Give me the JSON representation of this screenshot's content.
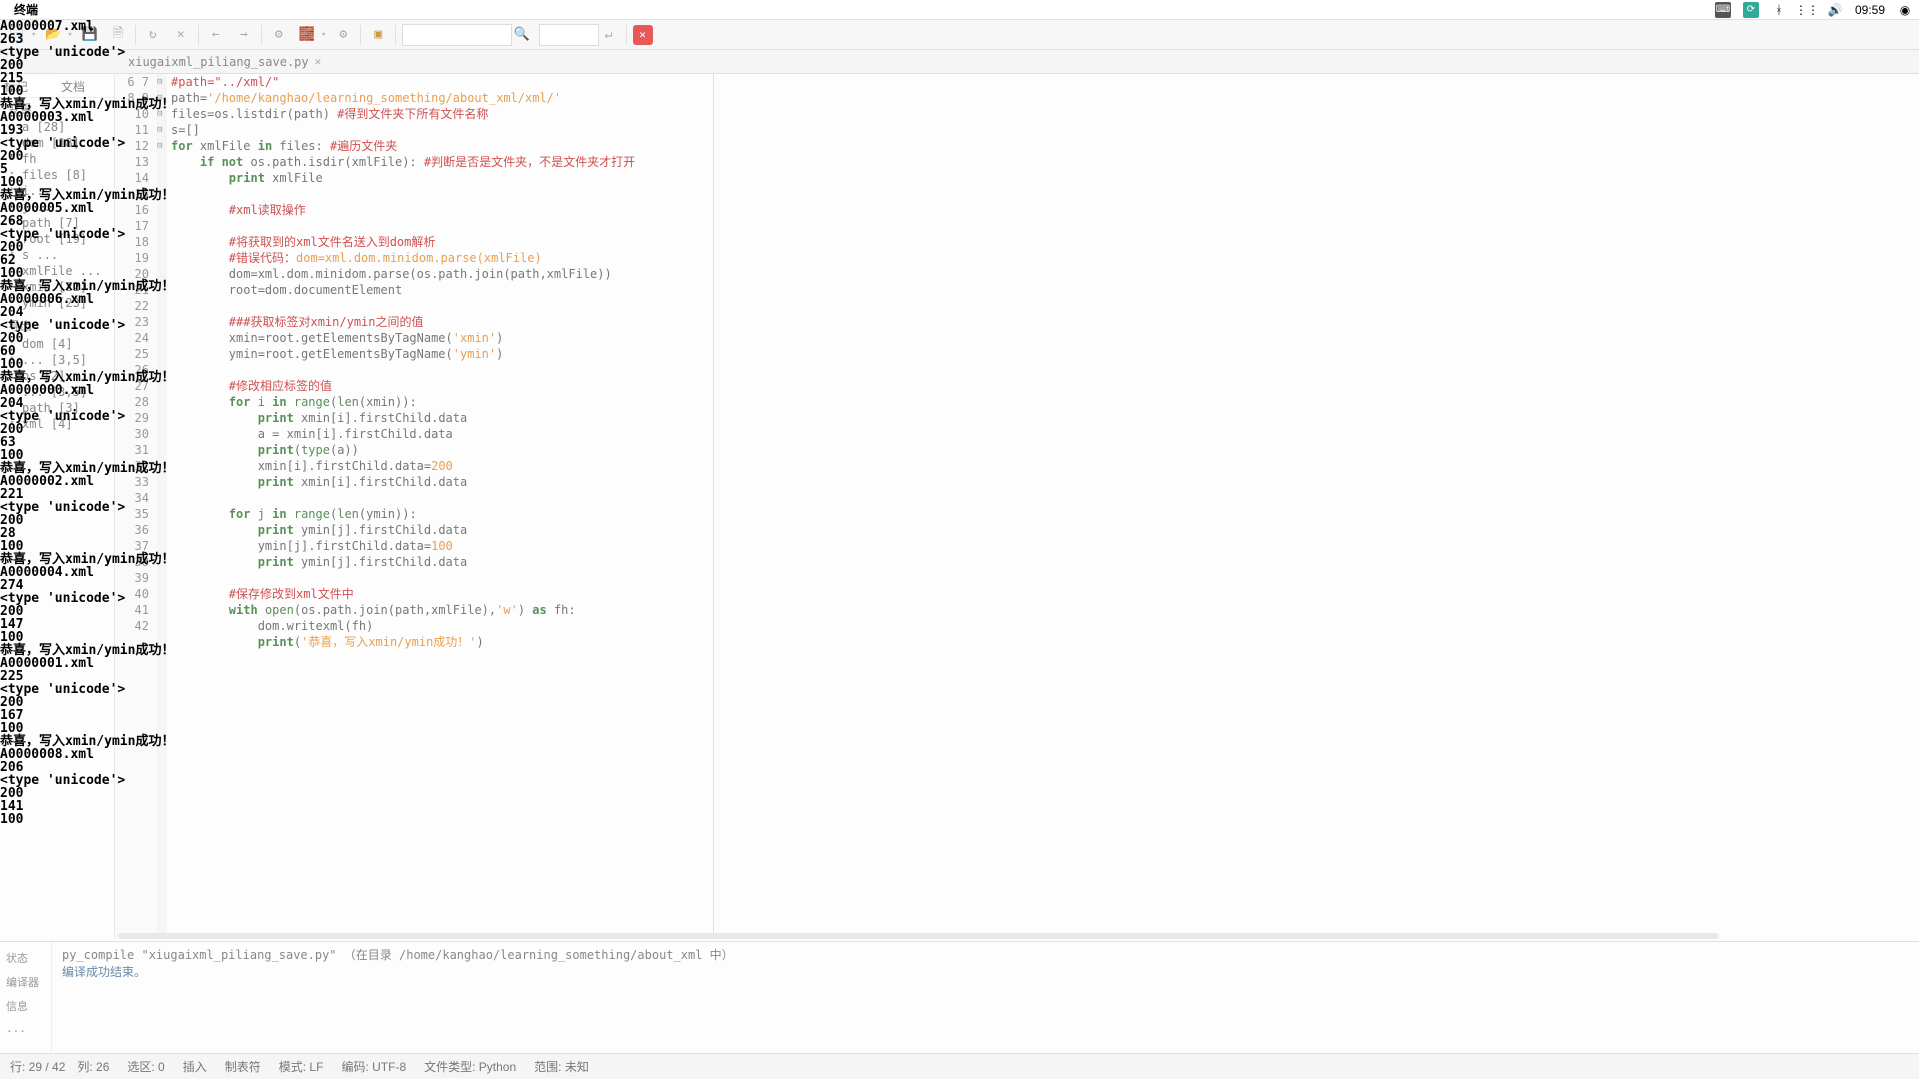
{
  "menubar": {
    "app_name": "终端",
    "right": {
      "time": "09:59"
    }
  },
  "toolbar": {
    "search1_placeholder": "",
    "search2_placeholder": ""
  },
  "tab": {
    "filename": "xiugaixml_piliang_save.py"
  },
  "sidebar": {
    "tab_symbols": "标记",
    "tab_docs": "文档",
    "hdr_vars": "变量",
    "hdr_export": "导出",
    "items_vars": [
      {
        "label": "a [28]"
      },
      {
        "label": "dom [18]"
      },
      {
        "label": "fh",
        "sub": "..."
      },
      {
        "label": "files [8]"
      },
      {
        "label": "i..."
      },
      {
        "label": "j..."
      },
      {
        "label": "path [7]"
      },
      {
        "label": "root [19]"
      },
      {
        "label": "s ..."
      },
      {
        "label": "xmlFile ..."
      },
      {
        "label": "xmin [22]"
      },
      {
        "label": "ymin [23]"
      }
    ],
    "items_export": [
      {
        "label": "dom [4]"
      },
      {
        "label": "... [3,5]"
      },
      {
        "label": "os [2]"
      },
      {
        "label": "... [3,5]"
      },
      {
        "label": "path [3]"
      },
      {
        "label": "xml [4]"
      }
    ]
  },
  "code": {
    "first_line": 6,
    "lines": [
      {
        "n": 6,
        "html": "<span class='cm'>#path=\"../xml/\"</span>"
      },
      {
        "n": 7,
        "html": "path=<span class='str'>'/home/kanghao/learning_something/about_xml/xml/'</span>"
      },
      {
        "n": 8,
        "html": "files=os.listdir(path) <span class='cm'>#得到文件夹下所有文件名称</span>"
      },
      {
        "n": 9,
        "html": "s=[]"
      },
      {
        "n": 10,
        "html": "<span class='kw'>for</span> xmlFile <span class='kw'>in</span> files: <span class='cm'>#遍历文件夹</span>"
      },
      {
        "n": 11,
        "html": "    <span class='kw'>if not</span> os.path.isdir(xmlFile): <span class='cm'>#判断是否是文件夹，不是文件夹才打开</span>"
      },
      {
        "n": 12,
        "html": "        <span class='kw'>print</span> xmlFile"
      },
      {
        "n": 13,
        "html": ""
      },
      {
        "n": 14,
        "html": "        <span class='cm'>#xml读取操作</span>"
      },
      {
        "n": 15,
        "html": ""
      },
      {
        "n": 16,
        "html": "        <span class='cm'>#将获取到的xml文件名送入到dom解析</span>"
      },
      {
        "n": 17,
        "html": "        <span class='cm'>#错误代码：<span class='str'>dom=xml.dom.minidom.parse(xmlFile)</span></span>"
      },
      {
        "n": 18,
        "html": "        dom=xml.dom.minidom.parse(os.path.join(path,xmlFile))"
      },
      {
        "n": 19,
        "html": "        root=dom.documentElement"
      },
      {
        "n": 20,
        "html": ""
      },
      {
        "n": 21,
        "html": "        <span class='cm'>###获取标签对xmin/ymin之间的值</span>"
      },
      {
        "n": 22,
        "html": "        xmin=root.getElementsByTagName(<span class='str'>'xmin'</span>)"
      },
      {
        "n": 23,
        "html": "        ymin=root.getElementsByTagName(<span class='str'>'ymin'</span>)"
      },
      {
        "n": 24,
        "html": ""
      },
      {
        "n": 25,
        "html": "        <span class='cm'>#修改相应标签的值</span>"
      },
      {
        "n": 26,
        "html": "        <span class='kw'>for</span> i <span class='kw'>in</span> <span class='bi'>range</span>(<span class='bi'>len</span>(xmin)):"
      },
      {
        "n": 27,
        "html": "            <span class='kw'>print</span> xmin[i].firstChild.data"
      },
      {
        "n": 28,
        "html": "            a = xmin[i].firstChild.data"
      },
      {
        "n": 29,
        "html": "            <span class='kw'>print</span>(<span class='bi'>type</span>(a))"
      },
      {
        "n": 30,
        "html": "            xmin[i].firstChild.data=<span class='num'>200</span>"
      },
      {
        "n": 31,
        "html": "            <span class='kw'>print</span> xmin[i].firstChild.data"
      },
      {
        "n": 32,
        "html": ""
      },
      {
        "n": 33,
        "html": "        <span class='kw'>for</span> j <span class='kw'>in</span> <span class='bi'>range</span>(<span class='bi'>len</span>(ymin)):"
      },
      {
        "n": 34,
        "html": "            <span class='kw'>print</span> ymin[j].firstChild.data"
      },
      {
        "n": 35,
        "html": "            ymin[j].firstChild.data=<span class='num'>100</span>"
      },
      {
        "n": 36,
        "html": "            <span class='kw'>print</span> ymin[j].firstChild.data"
      },
      {
        "n": 37,
        "html": ""
      },
      {
        "n": 38,
        "html": "        <span class='cm'>#保存修改到xml文件中</span>"
      },
      {
        "n": 39,
        "html": "        <span class='kw'>with</span> <span class='bi'>open</span>(os.path.join(path,xmlFile),<span class='str'>'w'</span>) <span class='kw'>as</span> fh:"
      },
      {
        "n": 40,
        "html": "            dom.writexml(fh)"
      },
      {
        "n": 41,
        "html": "            <span class='kw'>print</span>(<span class='str'>'恭喜，写入xmin/ymin成功！'</span>)"
      },
      {
        "n": 42,
        "html": ""
      }
    ]
  },
  "compile_msg": {
    "cmd_prefix": "py_compile \"xiugaixml_piliang_save.py\"",
    "cmd_in": " （在目录 /home/kanghao/learning_something/about_xml 中）",
    "ok": "编译成功结束。"
  },
  "msgtabs": {
    "t1": "状态",
    "t2": "编译器",
    "t3": "信息",
    "t4": "..."
  },
  "statusbar": {
    "line_col": "行: 29 / 42　列: 26",
    "sel": "选区: 0",
    "ins": "插入",
    "tab": "制表符",
    "mode": "模式: LF",
    "enc": "编码: UTF-8",
    "ftype": "文件类型: Python",
    "scope": "范围: 未知"
  },
  "terminal_output": [
    "A0000007.xml",
    "263",
    "<type 'unicode'>",
    "200",
    "215",
    "100",
    "恭喜，写入xmin/ymin成功！",
    "A0000003.xml",
    "193",
    "<type 'unicode'>",
    "200",
    "5",
    "100",
    "恭喜，写入xmin/ymin成功！",
    "A0000005.xml",
    "268",
    "<type 'unicode'>",
    "200",
    "62",
    "100",
    "恭喜，写入xmin/ymin成功！",
    "A0000006.xml",
    "204",
    "<type 'unicode'>",
    "200",
    "60",
    "100",
    "恭喜，写入xmin/ymin成功！",
    "A0000000.xml",
    "204",
    "<type 'unicode'>",
    "200",
    "63",
    "100",
    "恭喜，写入xmin/ymin成功！",
    "A0000002.xml",
    "221",
    "<type 'unicode'>",
    "200",
    "28",
    "100",
    "恭喜，写入xmin/ymin成功！",
    "A0000004.xml",
    "274",
    "<type 'unicode'>",
    "200",
    "147",
    "100",
    "恭喜，写入xmin/ymin成功！",
    "A0000001.xml",
    "225",
    "<type 'unicode'>",
    "200",
    "167",
    "100",
    "恭喜，写入xmin/ymin成功！",
    "A0000008.xml",
    "206",
    "<type 'unicode'>",
    "200",
    "141",
    "100"
  ]
}
